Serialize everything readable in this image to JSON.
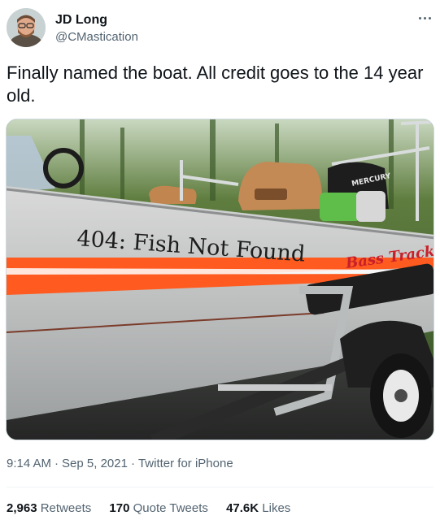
{
  "user": {
    "display_name": "JD Long",
    "handle": "@CMastication"
  },
  "tweet": {
    "text": "Finally named the boat. All credit goes to the 14 year old."
  },
  "media": {
    "boat_decal_text": "404: Fish Not Found",
    "brand_logo_text": "Bass Tracker",
    "motor_brand_text": "MERCURY"
  },
  "meta": {
    "time": "9:14 AM",
    "date": "Sep 5, 2021",
    "source": "Twitter for iPhone",
    "separator": "·"
  },
  "stats": {
    "retweets_count": "2,963",
    "retweets_label": "Retweets",
    "quote_count": "170",
    "quote_label": "Quote Tweets",
    "likes_count": "47.6K",
    "likes_label": "Likes"
  },
  "colors": {
    "text_primary": "#0f1419",
    "text_secondary": "#536471",
    "border": "#eff3f4",
    "stripe_orange": "#ff5a1f"
  },
  "icons": [
    "more-options-icon"
  ]
}
